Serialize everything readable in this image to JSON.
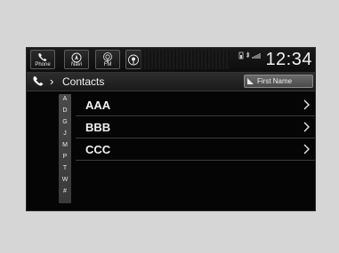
{
  "header": {
    "buttons": [
      {
        "label": "Phone",
        "icon": "phone-icon"
      },
      {
        "label": "Navi",
        "icon": "navi-icon"
      },
      {
        "label": "FM",
        "icon": "fm-icon"
      },
      {
        "label": "",
        "icon": "carplay-icon"
      }
    ],
    "status_icons": [
      "battery-icon",
      "bluetooth-icon",
      "signal-icon"
    ],
    "clock": "12:34"
  },
  "titlebar": {
    "icon": "phone-icon",
    "title": "Contacts",
    "sort_label": "First Name"
  },
  "alpha_index": [
    "A",
    "D",
    "G",
    "J",
    "M",
    "P",
    "T",
    "W",
    "#"
  ],
  "contacts": [
    {
      "name": "AAA"
    },
    {
      "name": "BBB"
    },
    {
      "name": "CCC"
    }
  ],
  "colors": {
    "background": "#d6d6d6",
    "screen": "#050505",
    "text": "#f2f2f2"
  }
}
